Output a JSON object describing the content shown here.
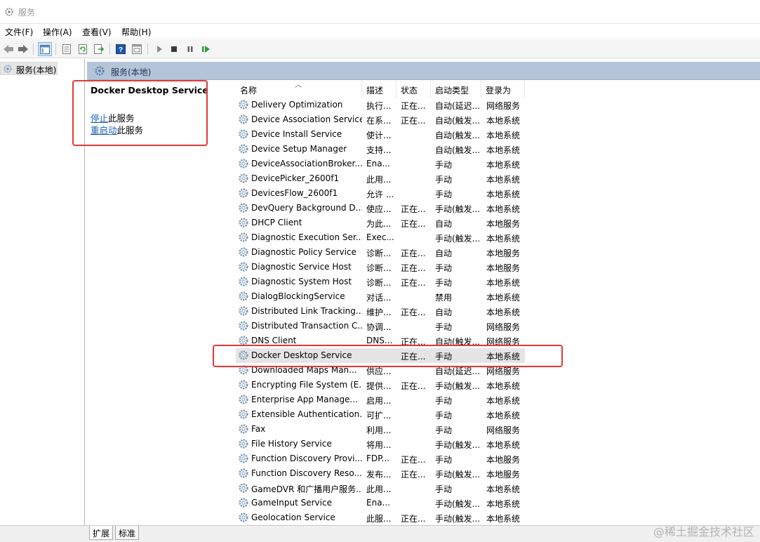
{
  "window": {
    "title": "服务"
  },
  "menu": [
    {
      "label": "文件(F)"
    },
    {
      "label": "操作(A)"
    },
    {
      "label": "查看(V)"
    },
    {
      "label": "帮助(H)"
    }
  ],
  "toolbar": {
    "icons": [
      "back-arrow-icon",
      "forward-arrow-icon",
      "console-tree-icon",
      "properties-icon",
      "refresh-icon",
      "export-icon",
      "help-icon",
      "view-icon",
      "start-icon",
      "stop-icon",
      "pause-icon",
      "restart-icon"
    ]
  },
  "tree": {
    "root_label": "服务(本地)"
  },
  "header": {
    "title": "服务(本地)"
  },
  "extended": {
    "service_name": "Docker Desktop Service",
    "stop_link": "停止",
    "stop_suffix": "此服务",
    "restart_link": "重启动",
    "restart_suffix": "此服务"
  },
  "columns": [
    "名称",
    "描述",
    "状态",
    "启动类型",
    "登录为"
  ],
  "services": [
    {
      "name": "Delivery Optimization",
      "desc": "执行...",
      "status": "正在...",
      "start": "自动(延迟...",
      "logon": "网络服务"
    },
    {
      "name": "Device Association Service",
      "desc": "在系...",
      "status": "正在...",
      "start": "自动(触发...",
      "logon": "本地系统"
    },
    {
      "name": "Device Install Service",
      "desc": "使计...",
      "status": "",
      "start": "自动(触发...",
      "logon": "本地系统"
    },
    {
      "name": "Device Setup Manager",
      "desc": "支持...",
      "status": "",
      "start": "自动(触发...",
      "logon": "本地系统"
    },
    {
      "name": "DeviceAssociationBroker...",
      "desc": "Ena...",
      "status": "",
      "start": "手动",
      "logon": "本地系统"
    },
    {
      "name": "DevicePicker_2600f1",
      "desc": "此用...",
      "status": "",
      "start": "手动",
      "logon": "本地系统"
    },
    {
      "name": "DevicesFlow_2600f1",
      "desc": "允许 ...",
      "status": "",
      "start": "手动",
      "logon": "本地系统"
    },
    {
      "name": "DevQuery Background D...",
      "desc": "使应...",
      "status": "正在...",
      "start": "手动(触发...",
      "logon": "本地系统"
    },
    {
      "name": "DHCP Client",
      "desc": "为此...",
      "status": "正在...",
      "start": "自动",
      "logon": "本地服务"
    },
    {
      "name": "Diagnostic Execution Ser...",
      "desc": "Exec...",
      "status": "",
      "start": "手动(触发...",
      "logon": "本地系统"
    },
    {
      "name": "Diagnostic Policy Service",
      "desc": "诊断...",
      "status": "正在...",
      "start": "自动",
      "logon": "本地服务"
    },
    {
      "name": "Diagnostic Service Host",
      "desc": "诊断...",
      "status": "正在...",
      "start": "手动",
      "logon": "本地服务"
    },
    {
      "name": "Diagnostic System Host",
      "desc": "诊断...",
      "status": "正在...",
      "start": "手动",
      "logon": "本地系统"
    },
    {
      "name": "DialogBlockingService",
      "desc": "对话...",
      "status": "",
      "start": "禁用",
      "logon": "本地系统"
    },
    {
      "name": "Distributed Link Tracking...",
      "desc": "维护...",
      "status": "正在...",
      "start": "自动",
      "logon": "本地系统"
    },
    {
      "name": "Distributed Transaction C...",
      "desc": "协调...",
      "status": "",
      "start": "手动",
      "logon": "网络服务"
    },
    {
      "name": "DNS Client",
      "desc": "DNS...",
      "status": "正在...",
      "start": "自动(触发...",
      "logon": "网络服务"
    },
    {
      "name": "Docker Desktop Service",
      "desc": "",
      "status": "正在...",
      "start": "手动",
      "logon": "本地系统",
      "selected": true
    },
    {
      "name": "Downloaded Maps Man...",
      "desc": "供应...",
      "status": "",
      "start": "自动(延迟...",
      "logon": "网络服务"
    },
    {
      "name": "Encrypting File System (E...",
      "desc": "提供...",
      "status": "正在...",
      "start": "手动(触发...",
      "logon": "本地系统"
    },
    {
      "name": "Enterprise App Manage...",
      "desc": "启用...",
      "status": "",
      "start": "手动",
      "logon": "本地系统"
    },
    {
      "name": "Extensible Authentication...",
      "desc": "可扩...",
      "status": "",
      "start": "手动",
      "logon": "本地系统"
    },
    {
      "name": "Fax",
      "desc": "利用...",
      "status": "",
      "start": "手动",
      "logon": "网络服务"
    },
    {
      "name": "File History Service",
      "desc": "将用...",
      "status": "",
      "start": "手动(触发...",
      "logon": "本地系统"
    },
    {
      "name": "Function Discovery Provi...",
      "desc": "FDP...",
      "status": "正在...",
      "start": "手动",
      "logon": "本地服务"
    },
    {
      "name": "Function Discovery Reso...",
      "desc": "发布...",
      "status": "正在...",
      "start": "手动(触发...",
      "logon": "本地服务"
    },
    {
      "name": "GameDVR 和广播用户服务...",
      "desc": "此用...",
      "status": "",
      "start": "手动",
      "logon": "本地系统"
    },
    {
      "name": "GameInput Service",
      "desc": "Ena...",
      "status": "",
      "start": "手动(触发...",
      "logon": "本地系统"
    },
    {
      "name": "Geolocation Service",
      "desc": "此服...",
      "status": "正在...",
      "start": "手动(触发...",
      "logon": "本地系统"
    }
  ],
  "tabs": [
    {
      "label": "扩展"
    },
    {
      "label": "标准"
    }
  ],
  "watermark": "@稀土掘金技术社区",
  "colors": {
    "header_bg": "#b4c5d9",
    "highlight": "#e53935",
    "link": "#1a5fb4"
  }
}
